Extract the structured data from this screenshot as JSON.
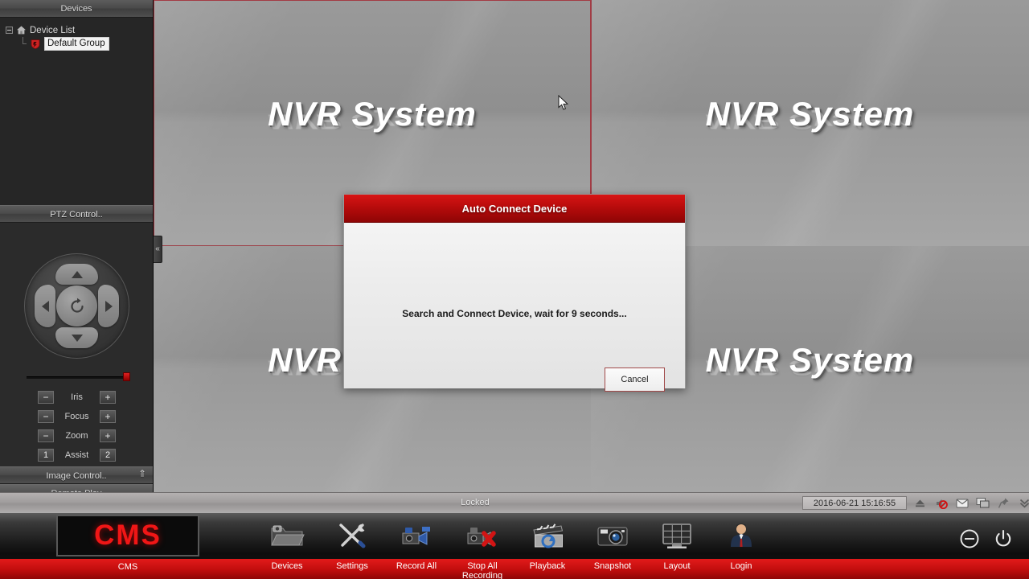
{
  "sidebar": {
    "devices_header": "Devices",
    "tree": {
      "root": {
        "label": "Device List",
        "icon": "home-icon"
      },
      "child": {
        "label": "Default Group",
        "icon": "shield-icon",
        "selected": true
      }
    },
    "ptz": {
      "header": "PTZ Control..",
      "rows": [
        {
          "name": "Iris",
          "minus": "−",
          "plus": "+"
        },
        {
          "name": "Focus",
          "minus": "−",
          "plus": "+"
        },
        {
          "name": "Zoom",
          "minus": "−",
          "plus": "+"
        },
        {
          "name": "Assist",
          "minus": "1",
          "plus": "2"
        }
      ]
    },
    "image_control_header": "Image Control..",
    "remote_play_header": "Remote Play",
    "collapse_chevron": "«"
  },
  "video": {
    "watermark": "NVR System",
    "cells": [
      {
        "id": 1,
        "label": "NVR System",
        "selected": true
      },
      {
        "id": 2,
        "label": "NVR System",
        "selected": false
      },
      {
        "id": 3,
        "label": "NVR System",
        "selected": false
      },
      {
        "id": 4,
        "label": "NVR System",
        "selected": false
      }
    ],
    "selection_color": "#9d4048"
  },
  "status_bar": {
    "locked_text": "Locked",
    "timestamp": "2016-06-21 15:16:55",
    "icons": [
      "eject-icon",
      "mute-speaker-icon",
      "mail-icon",
      "display-icon",
      "pin-icon",
      "chevron-double-down-icon"
    ]
  },
  "toolbar": {
    "logo_text": "CMS",
    "logo_label": "CMS",
    "accent_color": "#c00d0d",
    "items": [
      {
        "label": "Devices",
        "icon": "devices-folder-icon"
      },
      {
        "label": "Settings",
        "icon": "tools-icon"
      },
      {
        "label": "Record All",
        "icon": "camcorder-record-icon"
      },
      {
        "label": "Stop All Recording",
        "icon": "camcorder-stop-icon"
      },
      {
        "label": "Playback",
        "icon": "clapperboard-icon"
      },
      {
        "label": "Snapshot",
        "icon": "camera-icon"
      },
      {
        "label": "Layout",
        "icon": "monitor-grid-icon"
      },
      {
        "label": "Login",
        "icon": "user-icon"
      }
    ],
    "window_buttons": [
      {
        "name": "minimize-button",
        "icon": "minus-circle-icon"
      },
      {
        "name": "power-button",
        "icon": "power-icon"
      }
    ]
  },
  "dialog": {
    "title": "Auto Connect Device",
    "message": "Search and Connect Device, wait for 9 seconds...",
    "cancel_label": "Cancel"
  }
}
